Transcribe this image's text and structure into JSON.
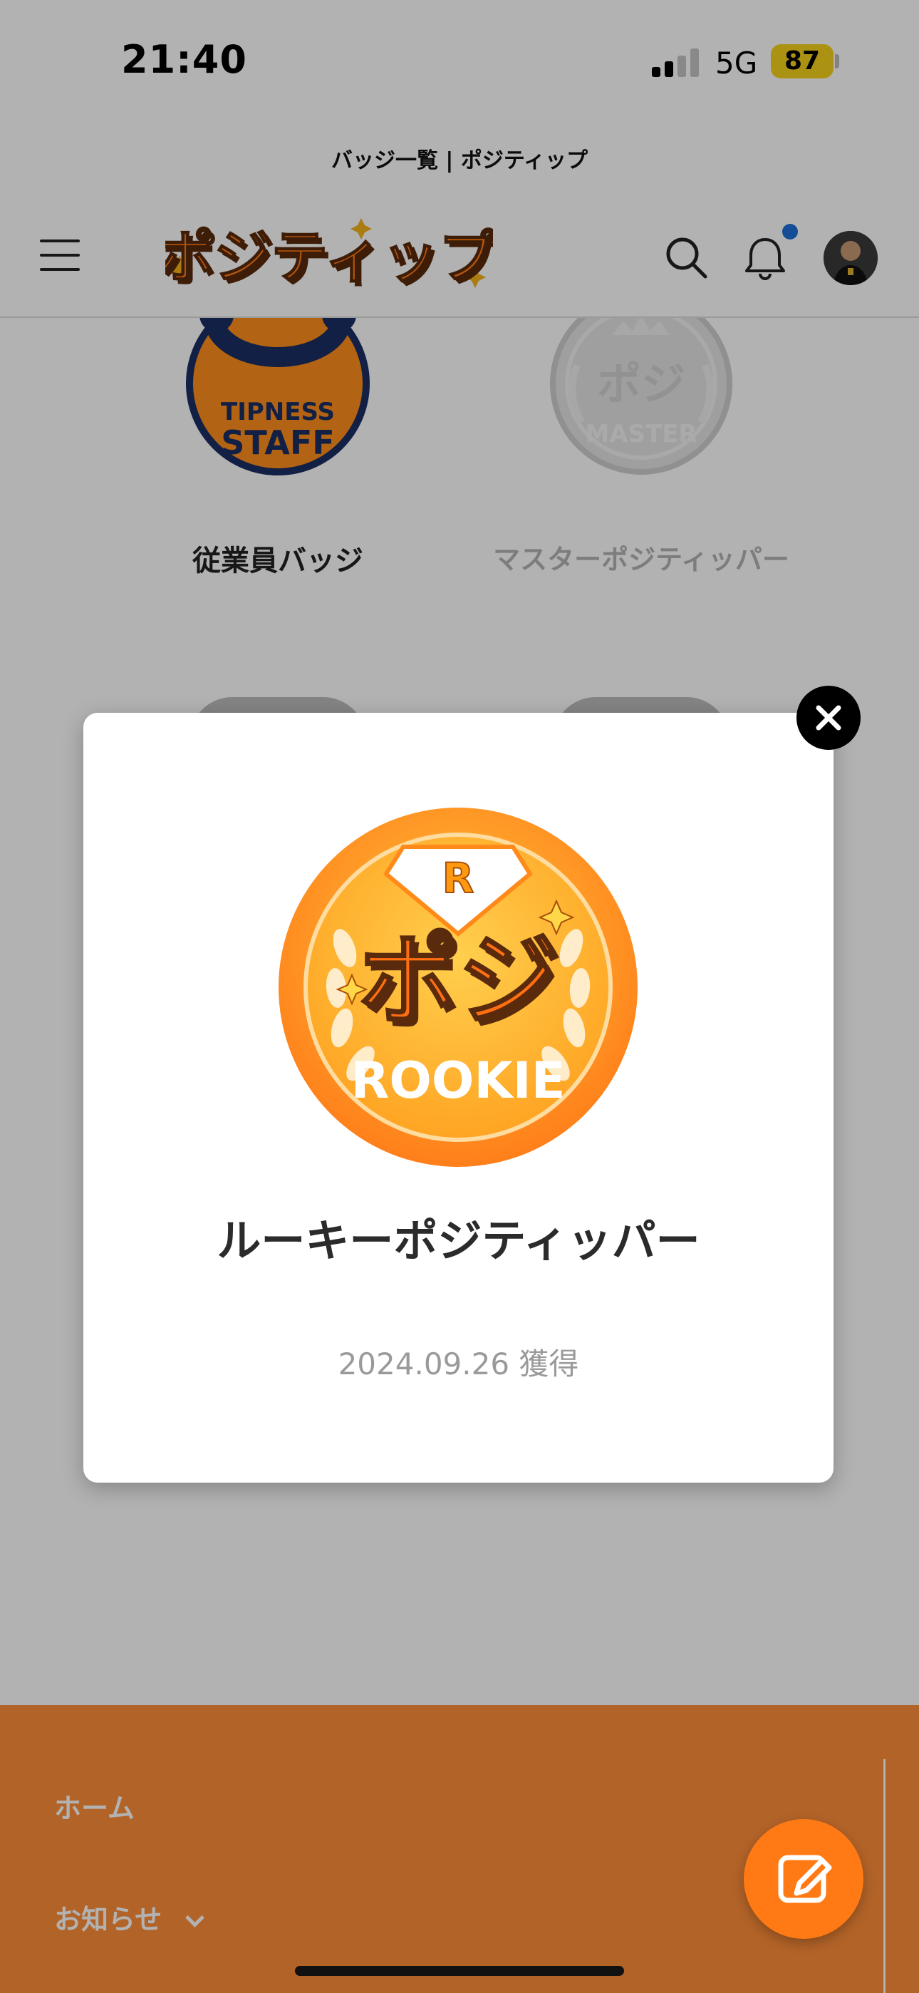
{
  "status_bar": {
    "time": "21:40",
    "network": "5G",
    "battery": "87"
  },
  "browser": {
    "page_title": "バッジ一覧 | ポジティップ"
  },
  "header": {
    "logo_text": "ポジティップ"
  },
  "badges": [
    {
      "label": "従業員バッジ",
      "text_line1": "TIPNESS",
      "text_line2": "STAFF"
    },
    {
      "label": "マスターポジティッパー",
      "badge_text": "MASTER",
      "badge_logo": "ポジ"
    }
  ],
  "modal": {
    "badge_letter": "R",
    "badge_logo": "ポジ",
    "badge_text": "ROOKIE",
    "title": "ルーキーポジティッパー",
    "date": "2024.09.26 獲得"
  },
  "footer": {
    "items": [
      {
        "label": "ホーム"
      },
      {
        "label": "お知らせ"
      }
    ]
  },
  "colors": {
    "accent_orange": "#ff7a14",
    "footer_bg": "#ff8f3a",
    "notif_blue": "#1a6fd6",
    "battery_yellow": "#f7d21c"
  }
}
